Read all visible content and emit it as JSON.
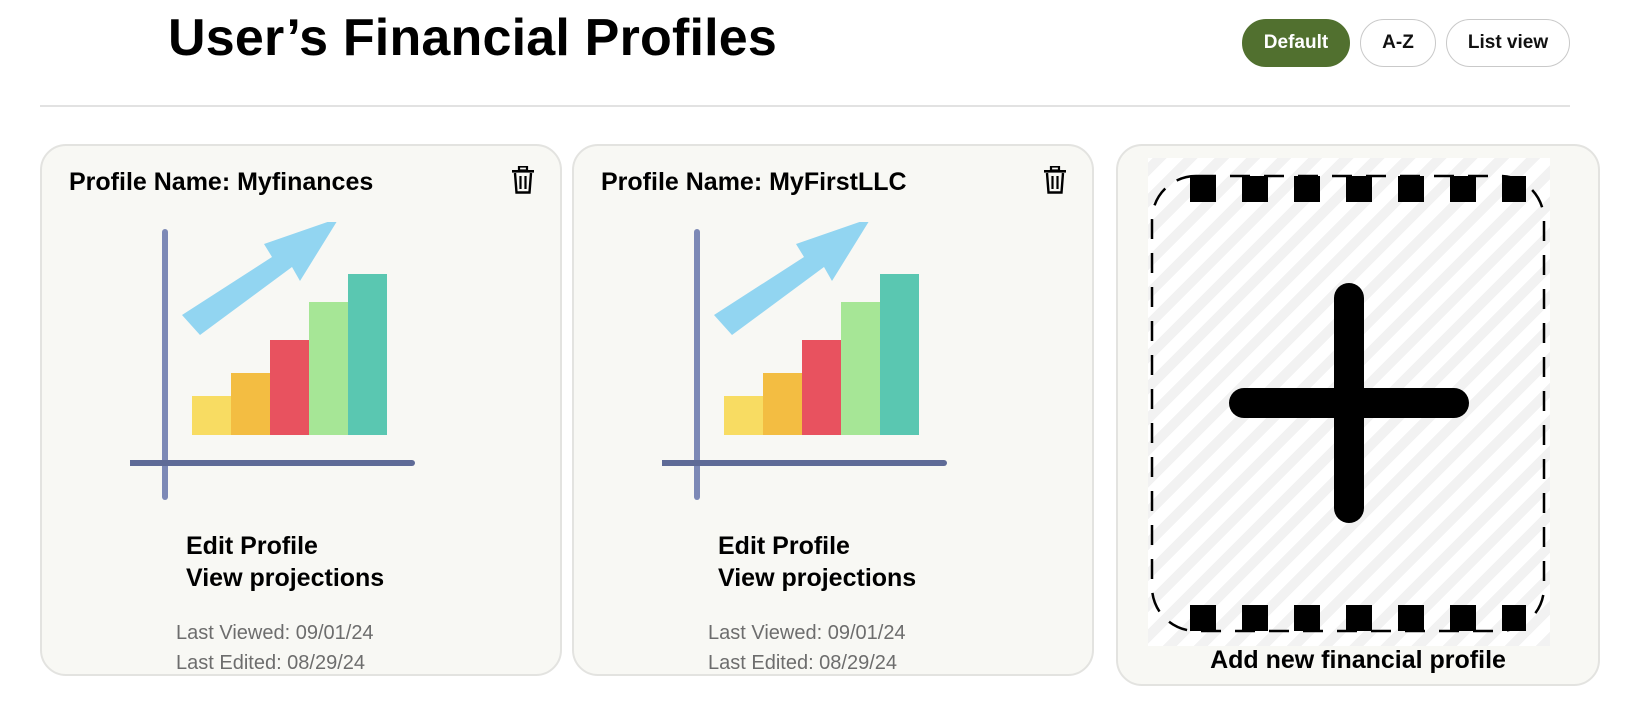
{
  "header": {
    "title": "User’s Financial Profiles",
    "view_options": [
      {
        "label": "Default",
        "active": true
      },
      {
        "label": "A-Z",
        "active": false
      },
      {
        "label": "List view",
        "active": false
      }
    ],
    "active_color": "#51702f"
  },
  "profiles": [
    {
      "name": "Profile Name: Myfinances",
      "edit_label": "Edit Profile",
      "projections_label": "View projections",
      "last_viewed": "Last Viewed: 09/01/24",
      "last_edited": "Last Edited: 08/29/24",
      "icon": "trash-icon",
      "illustration": "growth-chart-illustration"
    },
    {
      "name": "Profile Name: MyFirstLLC",
      "edit_label": "Edit Profile",
      "projections_label": "View projections",
      "last_viewed": "Last Viewed: 09/01/24",
      "last_edited": "Last Edited: 08/29/24",
      "icon": "trash-icon",
      "illustration": "growth-chart-illustration"
    }
  ],
  "add_card": {
    "label": "Add new financial profile",
    "icon": "plus-icon"
  },
  "colors": {
    "card_bg": "#f8f8f4",
    "bars": [
      "#f8dc62",
      "#f3bd42",
      "#e8525f",
      "#a6e696",
      "#5ac7b1"
    ],
    "arrow": "#92d5f1",
    "axis": "#5f6b97"
  }
}
